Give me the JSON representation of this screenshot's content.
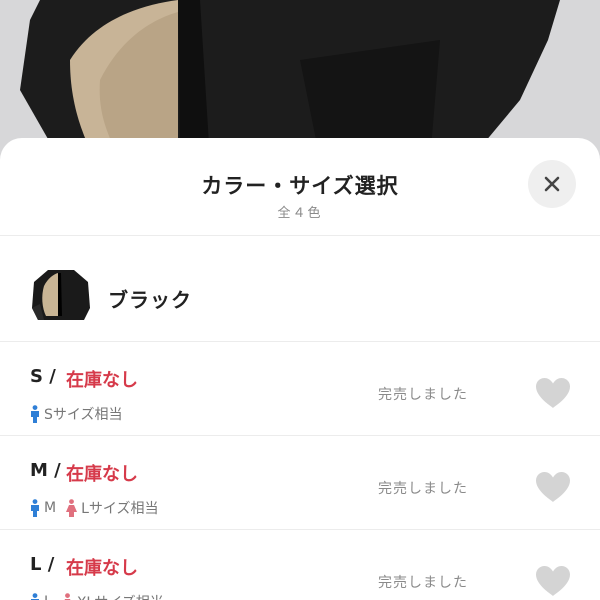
{
  "sheet": {
    "title": "カラー・サイズ選択",
    "subtitle": "全４色",
    "close_icon": "close-icon"
  },
  "color": {
    "name": "ブラック"
  },
  "sizes": [
    {
      "size": "S /",
      "stock": "在庫なし",
      "status": "完売しました",
      "guide": [
        {
          "icon": "male-icon",
          "text": "Sサイズ相当"
        }
      ]
    },
    {
      "size": "M /",
      "stock": "在庫なし",
      "status": "完売しました",
      "guide": [
        {
          "icon": "male-icon",
          "text": "M"
        },
        {
          "icon": "female-icon",
          "text": "Lサイズ相当"
        }
      ]
    },
    {
      "size": "L /",
      "stock": "在庫なし",
      "status": "完売しました",
      "guide": [
        {
          "icon": "male-icon",
          "text": "L"
        },
        {
          "icon": "female-icon",
          "text": "XLサイズ相当"
        }
      ]
    }
  ],
  "colors": {
    "out_of_stock": "#d63a4a",
    "male_icon": "#2f7fd6",
    "female_icon": "#e0707e",
    "heart_icon": "#d4d4d4"
  }
}
